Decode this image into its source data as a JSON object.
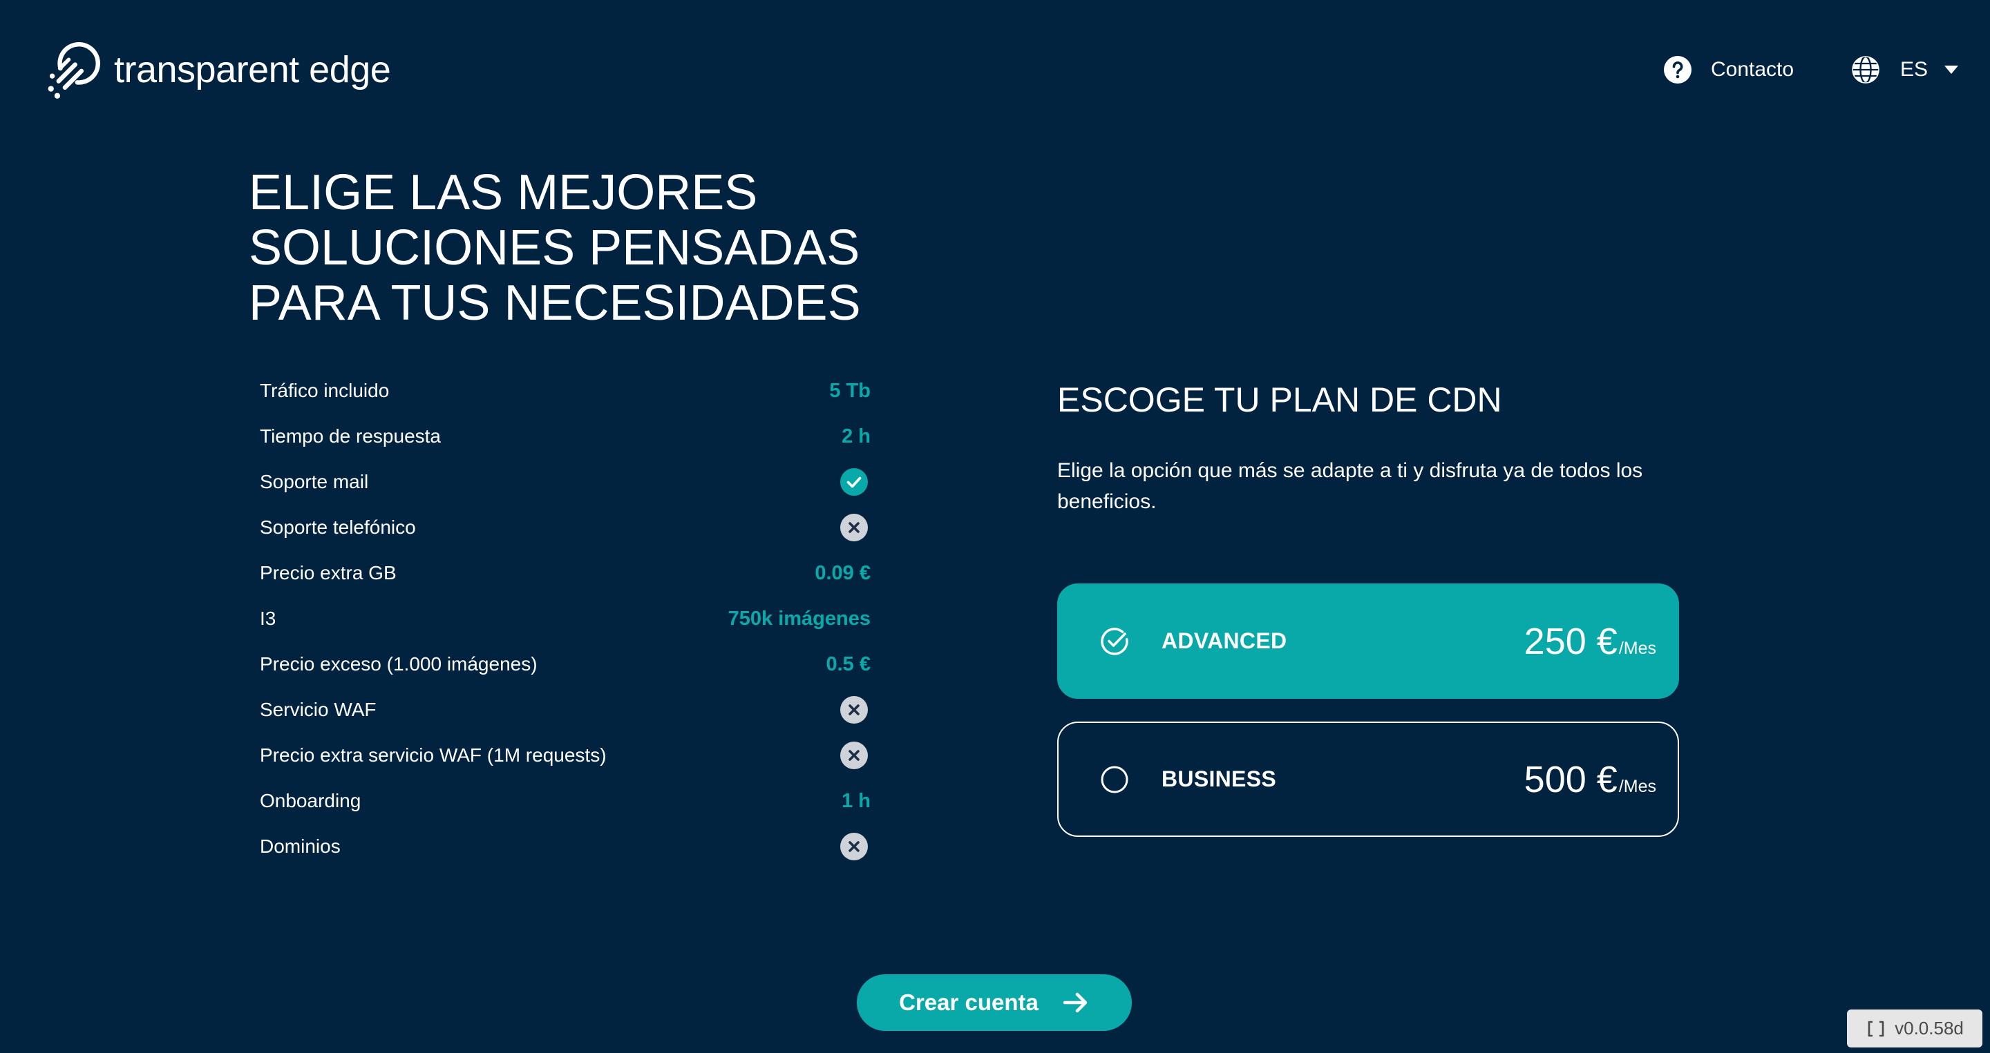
{
  "header": {
    "logo_icon": "transparent-edge-logo-icon",
    "brand_name": "transparent edge",
    "contact": {
      "icon": "help-circle-icon",
      "label": "Contacto"
    },
    "language": {
      "icon": "globe-icon",
      "value": "ES",
      "caret_icon": "caret-down-icon"
    }
  },
  "hero": {
    "title_lines": [
      "ELIGE LAS MEJORES",
      "SOLUCIONES PENSADAS",
      "PARA TUS NECESIDADES"
    ]
  },
  "features": [
    {
      "label": "Tráfico incluido",
      "value": "5 Tb"
    },
    {
      "label": "Tiempo de respuesta",
      "value": "2 h"
    },
    {
      "label": "Soporte mail",
      "icon": "check-circle-icon",
      "included": true
    },
    {
      "label": "Soporte telefónico",
      "icon": "x-circle-icon",
      "included": false
    },
    {
      "label": "Precio extra GB",
      "value": "0.09 €"
    },
    {
      "label": "I3",
      "value": "750k imágenes"
    },
    {
      "label": "Precio exceso (1.000 imágenes)",
      "value": "0.5 €"
    },
    {
      "label": "Servicio WAF",
      "icon": "x-circle-icon",
      "included": false
    },
    {
      "label": "Precio extra servicio WAF (1M requests)",
      "icon": "x-circle-icon",
      "included": false
    },
    {
      "label": "Onboarding",
      "value": "1 h"
    },
    {
      "label": "Dominios",
      "icon": "x-circle-icon",
      "included": false
    }
  ],
  "plans_section": {
    "title": "ESCOGE TU PLAN DE CDN",
    "description": "Elige la opción que más se adapte a ti y disfruta ya de todos los beneficios.",
    "plans": [
      {
        "name": "ADVANCED",
        "price": "250 €",
        "period": "/Mes",
        "selected": true,
        "icon": "check-circle-outline-icon"
      },
      {
        "name": "BUSINESS",
        "price": "500 €",
        "period": "/Mes",
        "selected": false,
        "icon": "radio-empty-icon"
      }
    ]
  },
  "cta": {
    "label": "Crear cuenta",
    "icon": "arrow-right-icon"
  },
  "version_badge": {
    "icon": "brackets-icon",
    "label": "v0.0.58d"
  },
  "colors": {
    "background": "#022340",
    "accent": "#0aa9a9",
    "text": "#ffffff",
    "muted_icon": "#cfd3d9",
    "icon_dark": "#1c2f44",
    "badge_background": "#e6e6e6",
    "badge_text": "#4a4a4a"
  }
}
